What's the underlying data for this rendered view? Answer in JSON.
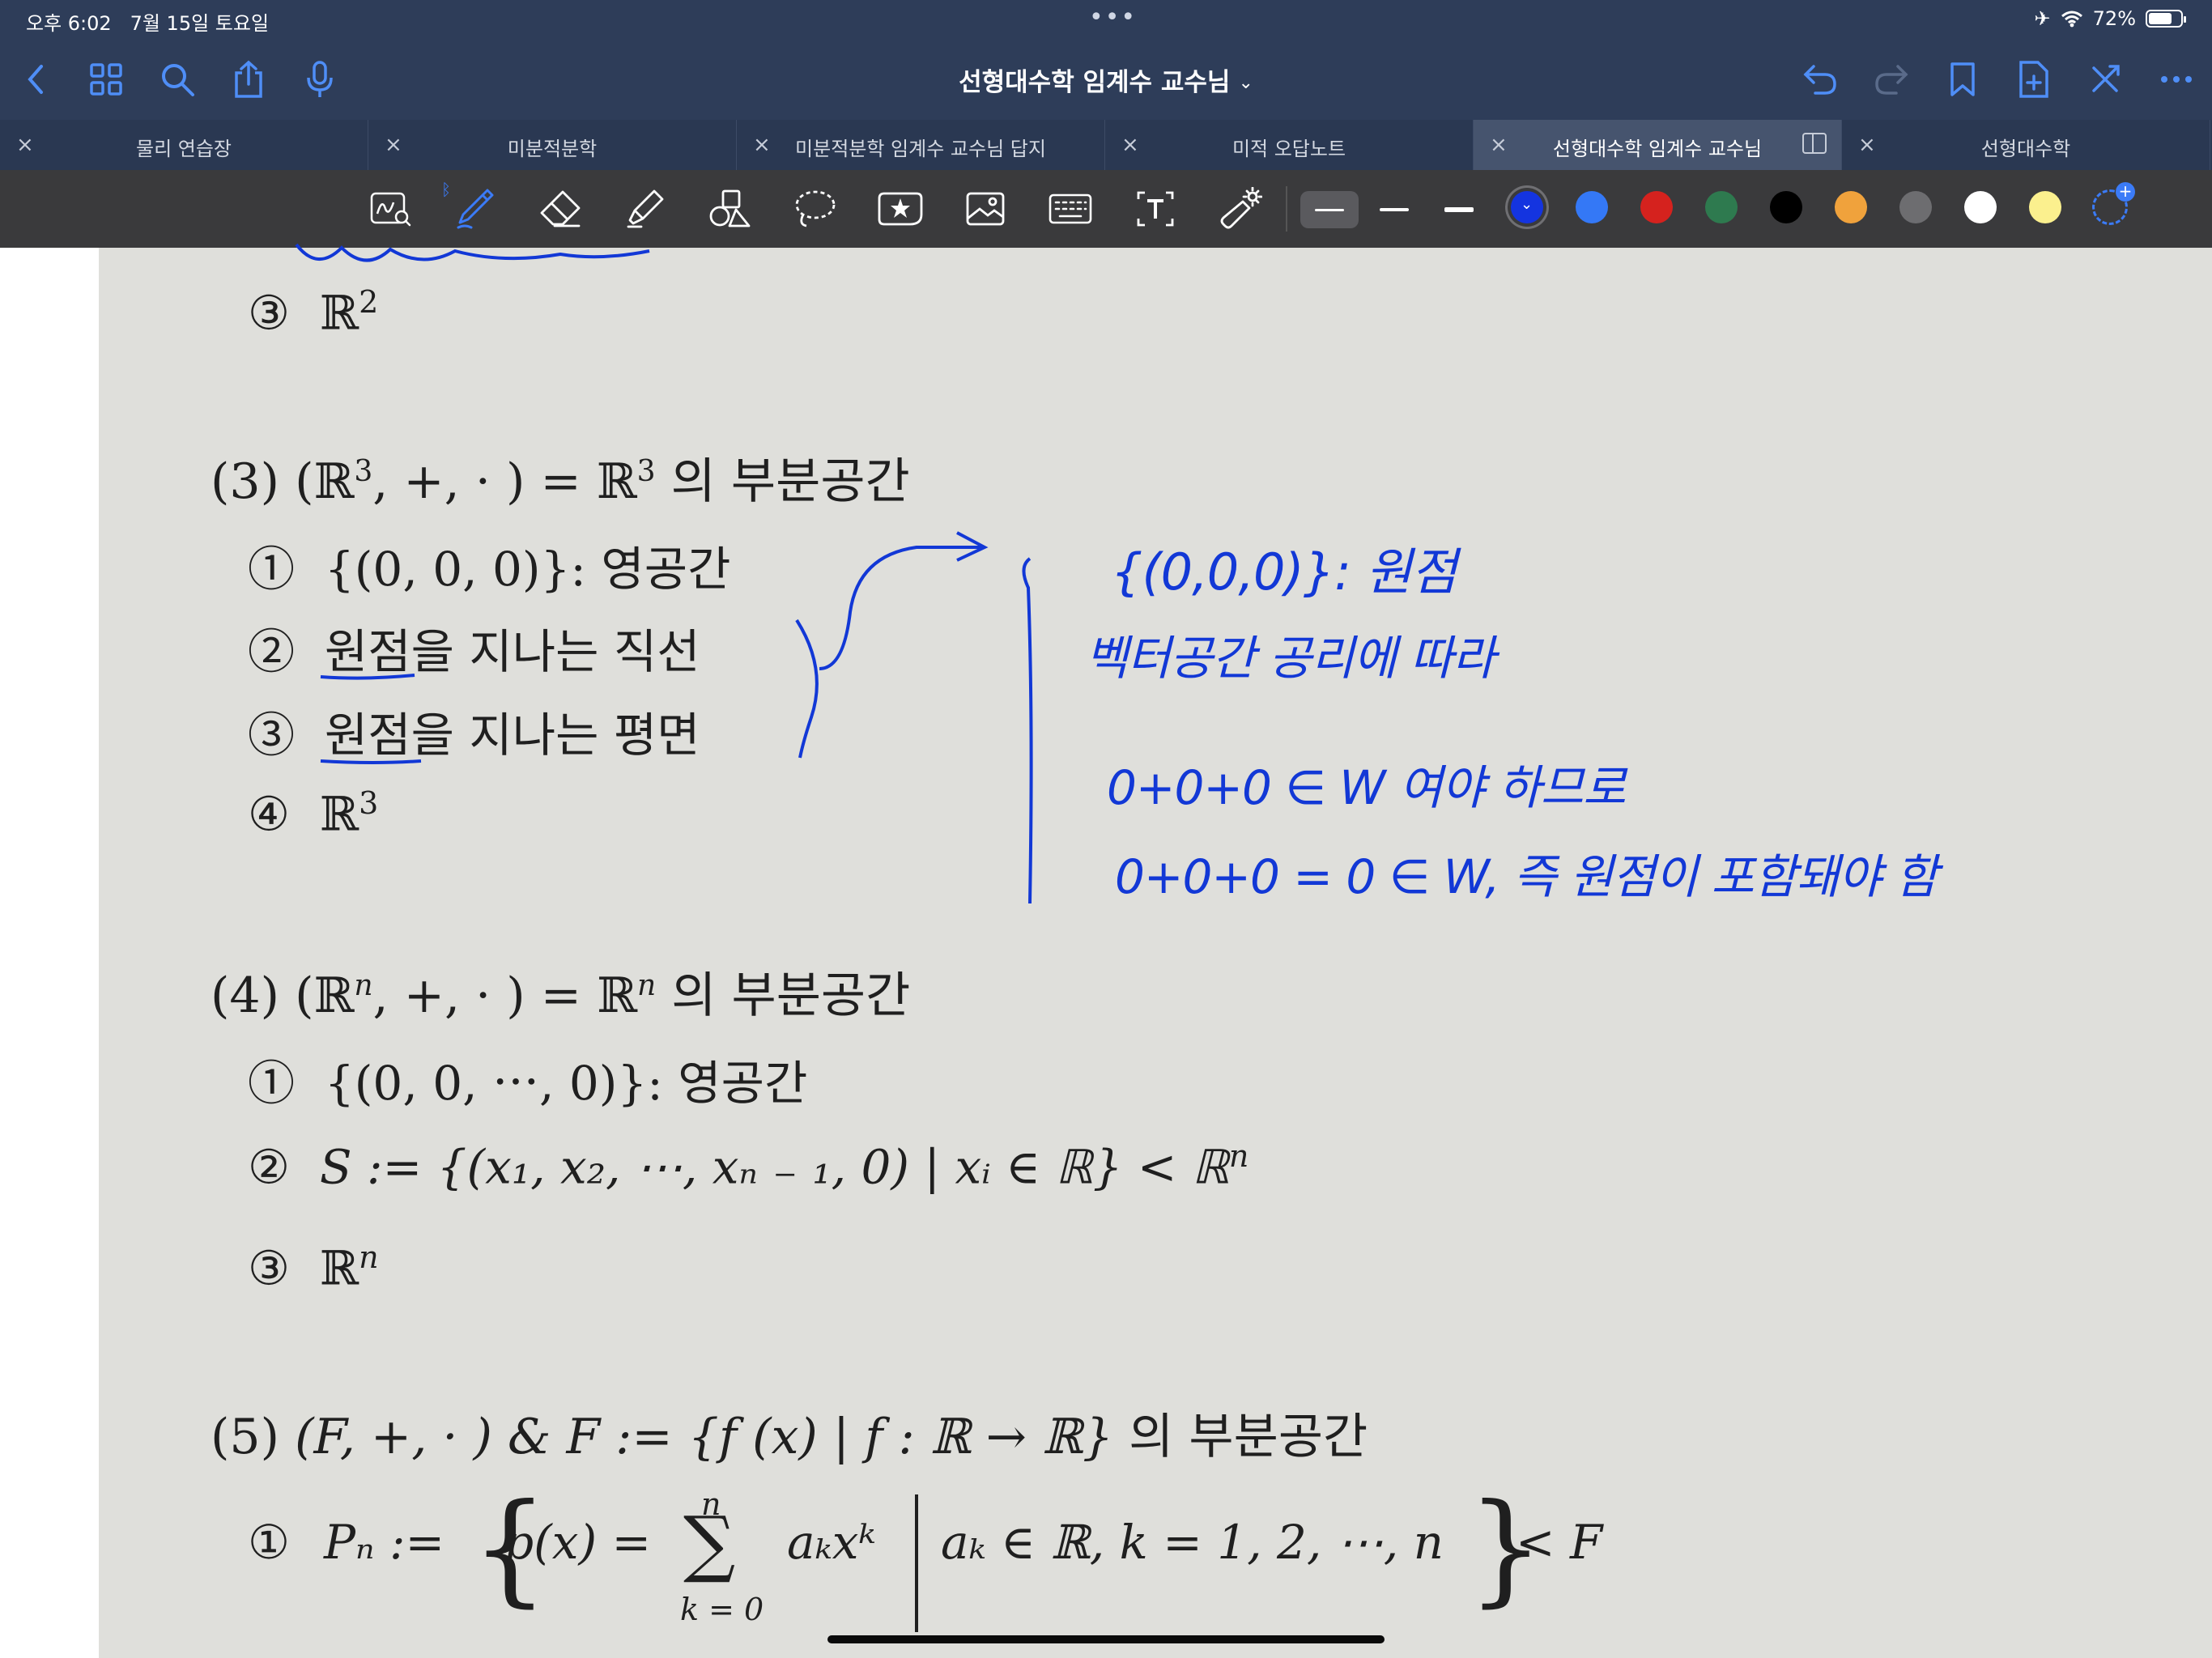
{
  "status_bar": {
    "time": "오후 6:02",
    "date": "7월 15일 토요일",
    "dots": "•••",
    "airplane": "✈",
    "wifi": "wifi-icon",
    "battery": "72%"
  },
  "title_bar": {
    "title": "선형대수학 임계수 교수님",
    "chevron": "⌄"
  },
  "tabs": [
    {
      "label": "물리 연습장",
      "close": "×",
      "active": false
    },
    {
      "label": "미분적분학",
      "close": "×",
      "active": false
    },
    {
      "label": "미분적분학 임계수 교수님 답지",
      "close": "×",
      "active": false
    },
    {
      "label": "미적 오답노트",
      "close": "×",
      "active": false
    },
    {
      "label": "선형대수학 임계수 교수님",
      "close": "×",
      "active": true
    },
    {
      "label": "선형대수학",
      "close": "×",
      "active": false
    }
  ],
  "toolbar": {
    "bluetooth_mark": "ᛒ",
    "colors": [
      "#1434e0",
      "#3478f6",
      "#d5221e",
      "#2e7a4f",
      "#000000",
      "#f0a23c",
      "#6d6d70",
      "#ffffff",
      "#fbf08e"
    ],
    "selected_color": "#1434e0",
    "check": "⌄",
    "add": "+"
  },
  "document": {
    "prev_item": {
      "num": "③",
      "text": "ℝ",
      "sup": "2"
    },
    "section3": {
      "head": "(3)",
      "expr": "(ℝ",
      "expr_sup": "3",
      "expr_rest": ", +,  · ) = ℝ",
      "expr_sup2": "3",
      "tail": "의 부분공간",
      "items": [
        {
          "num": "①",
          "text": "{(0, 0, 0)}:  영공간"
        },
        {
          "num": "②",
          "text": "원점을  지나는  직선"
        },
        {
          "num": "③",
          "text": "원점을  지나는  평면"
        },
        {
          "num": "④",
          "text": "ℝ",
          "sup": "3"
        }
      ]
    },
    "section4": {
      "head": "(4)",
      "expr": "(ℝ",
      "expr_sup": "n",
      "expr_rest": ", +,  · ) = ℝ",
      "expr_sup2": "n",
      "tail": "의 부분공간",
      "items": [
        {
          "num": "①",
          "text": "{(0, 0,  ⋯, 0)}:  영공간"
        },
        {
          "num": "②",
          "text": "S := {(x₁, x₂,  ⋯, xₙ ₋ ₁, 0) | xᵢ ∈ ℝ} < ℝ",
          "sup": "n"
        },
        {
          "num": "③",
          "text": "ℝ",
          "sup": "n"
        }
      ]
    },
    "section5": {
      "head": "(5)",
      "expr": "(F, +,  · ) & F := {f (x) | f : ℝ → ℝ}",
      "tail": "의 부분공간",
      "items": [
        {
          "num": "①",
          "lhs": "Pₙ :=",
          "brace_open": "{",
          "px": "p(x) =",
          "sum_top": "n",
          "sum": "∑",
          "sum_bot": "k = 0",
          "term": "aₖxᵏ",
          "cond": "aₖ ∈ ℝ,  k = 1, 2,  ⋯, n",
          "brace_close": "}",
          "rel": "< F"
        }
      ]
    },
    "handwriting": [
      "{(0,0,0)}: 원점",
      "벡터공간 공리에 따라",
      "0+0+0 ∈ W 여야 하므로",
      "0+0+0 = 0 ∈ W, 즉  원점이 포함돼야 함"
    ]
  }
}
